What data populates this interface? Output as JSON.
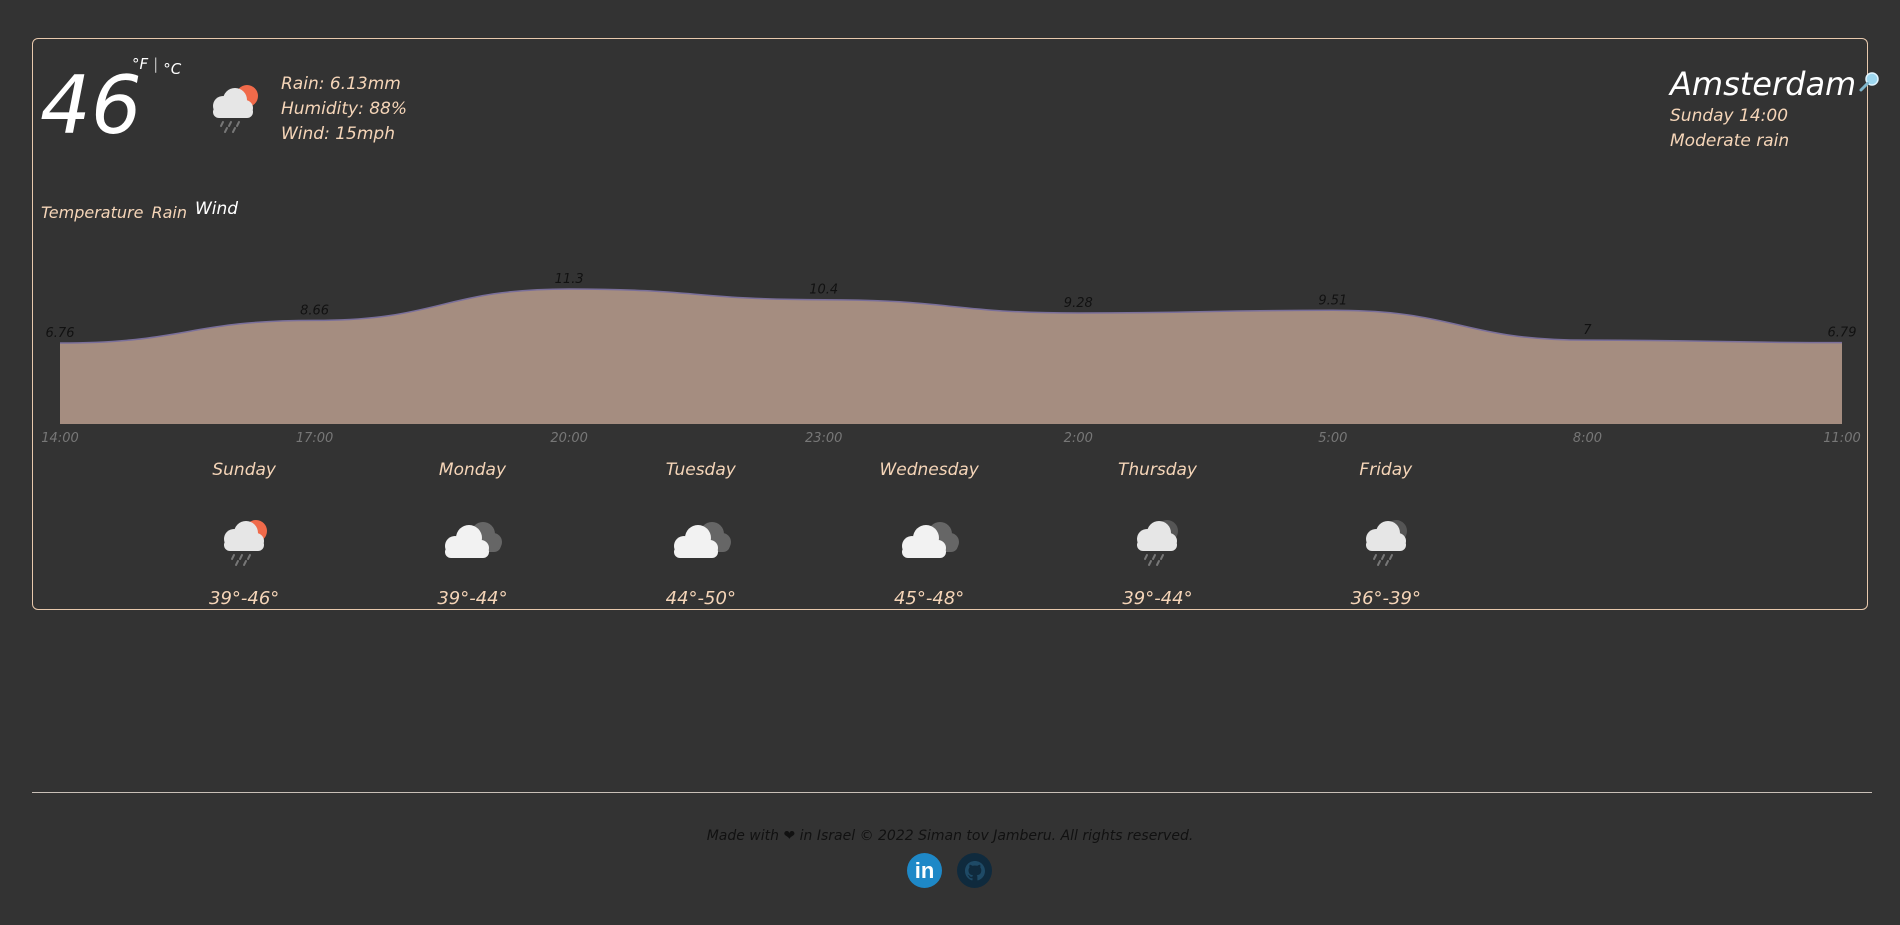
{
  "current": {
    "temp": "46",
    "unit_f": "°F",
    "unit_sep": "|",
    "unit_c": "°C",
    "icon": "cloud-rain-sun-icon",
    "rain": "Rain: 6.13mm",
    "humidity": "Humidity: 88%",
    "wind": "Wind: 15mph"
  },
  "location": {
    "city": "Amsterdam",
    "datetime": "Sunday 14:00",
    "condition": "Moderate rain"
  },
  "tabs": [
    {
      "label": "Temperature",
      "active": false
    },
    {
      "label": "Rain",
      "active": false
    },
    {
      "label": "Wind",
      "active": true
    }
  ],
  "chart_data": {
    "type": "area",
    "x": [
      "14:00",
      "17:00",
      "20:00",
      "23:00",
      "2:00",
      "5:00",
      "8:00",
      "11:00"
    ],
    "values": [
      6.76,
      8.66,
      11.3,
      10.4,
      9.28,
      9.51,
      7,
      6.79
    ],
    "value_labels": [
      "6.76",
      "8.66",
      "11.3",
      "10.4",
      "9.28",
      "9.51",
      "7",
      "6.79"
    ],
    "fill_color": "#a58d80",
    "line_color": "#7a6f9a"
  },
  "forecast": [
    {
      "day": "Sunday",
      "icon": "cloud-rain-sun-icon",
      "range": "39°-46°"
    },
    {
      "day": "Monday",
      "icon": "cloudy-icon",
      "range": "39°-44°"
    },
    {
      "day": "Tuesday",
      "icon": "cloudy-icon",
      "range": "44°-50°"
    },
    {
      "day": "Wednesday",
      "icon": "cloudy-icon",
      "range": "45°-48°"
    },
    {
      "day": "Thursday",
      "icon": "cloud-rain-icon",
      "range": "39°-44°"
    },
    {
      "day": "Friday",
      "icon": "cloud-rain-icon",
      "range": "36°-39°"
    }
  ],
  "footer": {
    "text": "Made with ❤ in Israel © 2022 Siman tov Jamberu. All rights reserved.",
    "linkedin_label": "in"
  },
  "colors": {
    "background": "#333333",
    "accent_text": "#f5d5b8",
    "linkedin": "#1e88c7",
    "github": "#0f2a3d"
  }
}
